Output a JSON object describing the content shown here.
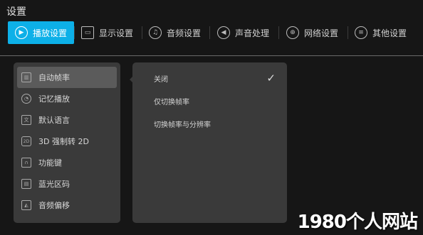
{
  "title": "设置",
  "tabs": [
    {
      "label": "播放设置",
      "icon": "play-icon",
      "active": true
    },
    {
      "label": "显示设置",
      "icon": "display-icon"
    },
    {
      "label": "音频设置",
      "icon": "audio-icon"
    },
    {
      "label": "声音处理",
      "icon": "speaker-icon"
    },
    {
      "label": "网络设置",
      "icon": "globe-icon"
    },
    {
      "label": "其他设置",
      "icon": "menu-icon"
    }
  ],
  "left_menu": [
    {
      "label": "自动帧率",
      "icon": "framerate-icon",
      "selected": true
    },
    {
      "label": "记忆播放",
      "icon": "clock-icon"
    },
    {
      "label": "默认语言",
      "icon": "language-icon"
    },
    {
      "label": "3D 强制转 2D",
      "icon": "2d-icon"
    },
    {
      "label": "功能键",
      "icon": "function-key-icon"
    },
    {
      "label": "蓝光区码",
      "icon": "bluray-icon"
    },
    {
      "label": "音频偏移",
      "icon": "audio-offset-icon"
    }
  ],
  "options": [
    {
      "label": "关闭",
      "checked": true
    },
    {
      "label": "仅切换帧率"
    },
    {
      "label": "切换帧率与分辨率"
    }
  ],
  "watermark": "1980个人网站",
  "colors": {
    "accent": "#0db0e8",
    "background": "#161616",
    "panel": "#3a3a3a",
    "selected": "#5b5b5b"
  }
}
